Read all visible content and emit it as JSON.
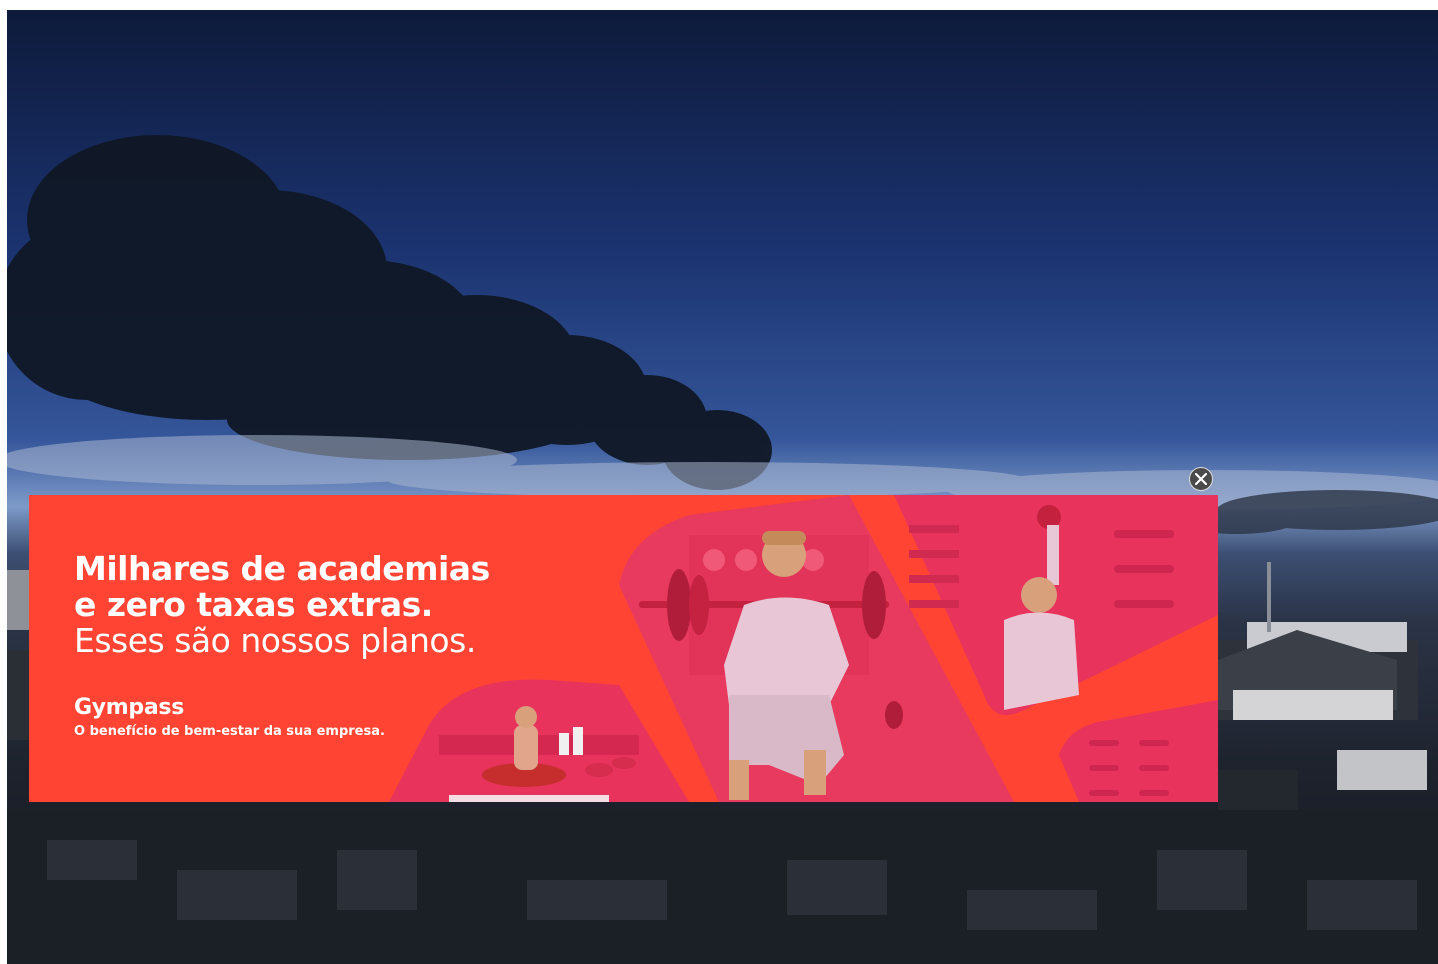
{
  "background": {
    "description_icon": "smoke-sky-photo-icon"
  },
  "ad": {
    "headline_line1": "Milhares de academias",
    "headline_line2": "e zero taxas extras.",
    "headline_line3": "Esses são nossos planos.",
    "brand": "Gympass",
    "tagline": "O benefício de bem-estar da sua empresa.",
    "brand_color": "#ff4433",
    "scene_color": "#e8335c",
    "close_icon": "close-icon"
  }
}
